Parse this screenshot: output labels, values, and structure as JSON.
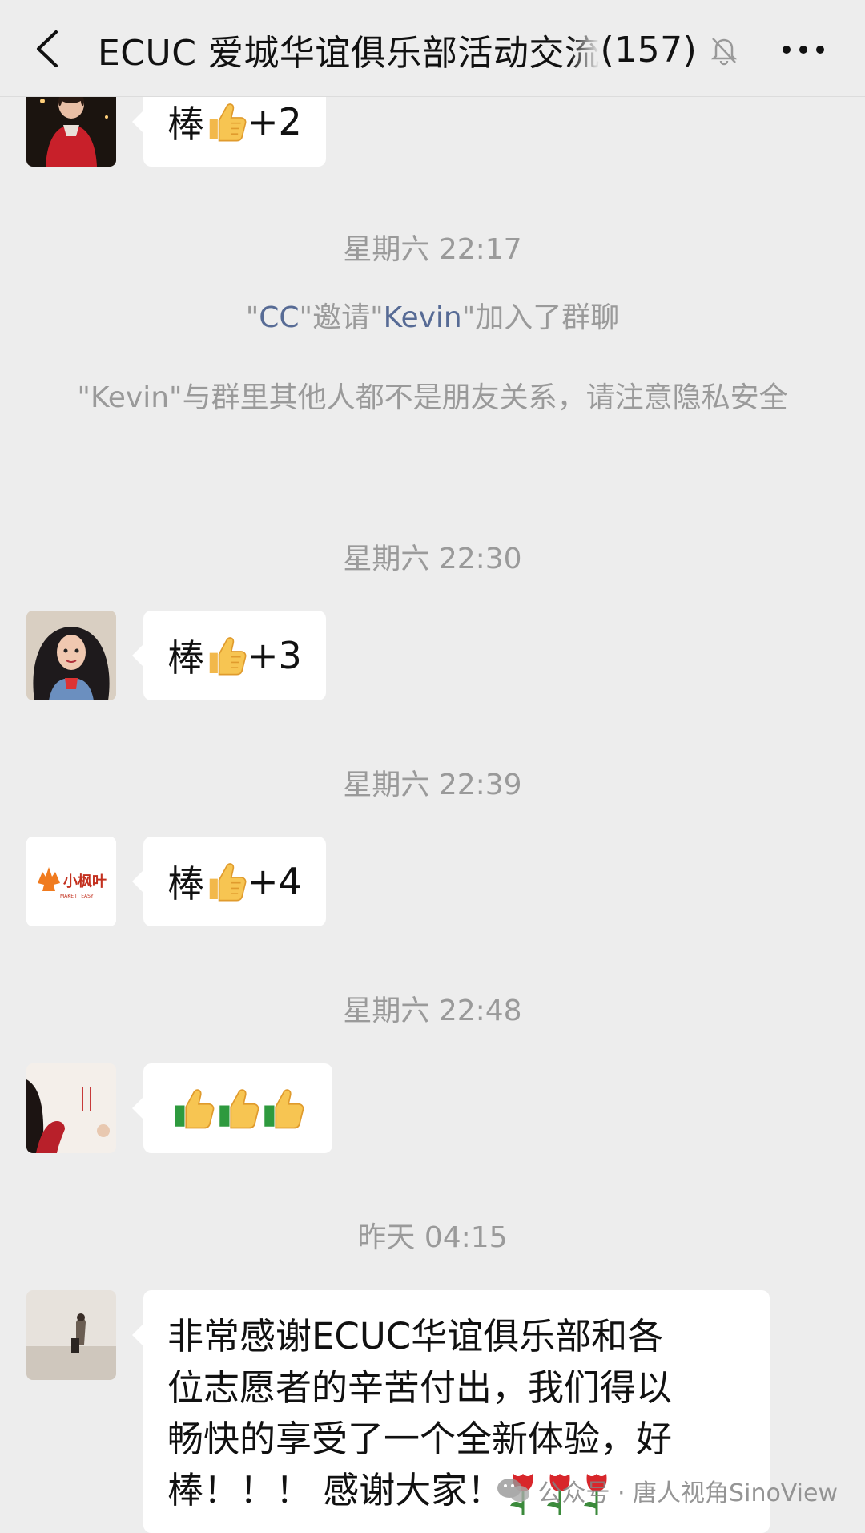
{
  "header": {
    "title": "ECUC 爱城华谊俱乐部活动交流",
    "count": "(157)",
    "back_icon": "chevron-left-icon",
    "mute_icon": "bell-slash-icon",
    "more_icon": "more-dots-icon"
  },
  "messages": [
    {
      "text": "棒",
      "suffix": "+2"
    },
    {
      "text": "棒",
      "suffix": "+3"
    },
    {
      "text": "棒",
      "suffix": "+4"
    },
    {
      "text": ""
    },
    {
      "lines": [
        "非常感谢ECUC华谊俱乐部和各",
        "位志愿者的辛苦付出，我们得以",
        "畅快的享受了一个全新体验，好",
        "棒！！！ 感谢大家！"
      ]
    }
  ],
  "timestamps": [
    "星期六 22:17",
    "星期六 22:30",
    "星期六 22:39",
    "星期六 22:48",
    "昨天 04:15"
  ],
  "system": {
    "invite": {
      "q1": "\"",
      "inviter": "CC",
      "mid": "\"邀请\"",
      "invitee": "Kevin",
      "tail": "\"加入了群聊"
    },
    "privacy_notice": "\"Kevin\"与群里其他人都不是朋友关系，请注意隐私安全"
  },
  "avatars": {
    "a4": {
      "logo_text": "小枫叶",
      "logo_sub": "MAKE IT EASY"
    }
  },
  "watermark": {
    "icon": "wechat-icon",
    "text": "公众号 · 唐人视角SinoView"
  },
  "colors": {
    "background": "#ededed",
    "bubble": "#ffffff",
    "name_link": "#576b95",
    "system_text": "#9a9a9a"
  }
}
